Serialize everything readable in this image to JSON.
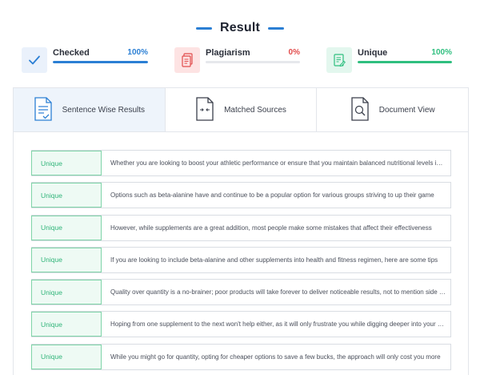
{
  "header": {
    "title": "Result"
  },
  "stats": [
    {
      "label": "Checked",
      "percent_text": "100%",
      "value": 1.0,
      "color": "#2b7fd4",
      "bg": "#eaf1fb",
      "icon": "checkmark-icon"
    },
    {
      "label": "Plagiarism",
      "percent_text": "0%",
      "value": 0.0,
      "color": "#e24c4c",
      "bg": "#fde3e3",
      "icon": "document-copy-icon"
    },
    {
      "label": "Unique",
      "percent_text": "100%",
      "value": 1.0,
      "color": "#2fbf7f",
      "bg": "#e3f7ee",
      "icon": "document-edit-icon"
    }
  ],
  "tabs": [
    {
      "label": "Sentence Wise Results",
      "icon": "sentence-document-icon",
      "active": true
    },
    {
      "label": "Matched Sources",
      "icon": "matched-sources-icon",
      "active": false
    },
    {
      "label": "Document View",
      "icon": "document-search-icon",
      "active": false
    }
  ],
  "results": [
    {
      "status": "Unique",
      "sentence": "Whether you are looking to boost your athletic performance or ensure that you maintain balanced nutritional levels in your diet"
    },
    {
      "status": "Unique",
      "sentence": "Options such as beta-alanine have and continue to be a popular option for various groups striving to up their game"
    },
    {
      "status": "Unique",
      "sentence": "However, while supplements are a great addition, most people make some mistakes that affect their effectiveness"
    },
    {
      "status": "Unique",
      "sentence": "If you are looking to include beta-alanine and other supplements into health and fitness regimen, here are some tips"
    },
    {
      "status": "Unique",
      "sentence": "Quality over quantity is a no-brainer; poor products will take forever to deliver noticeable results, not to mention side effects"
    },
    {
      "status": "Unique",
      "sentence": "Hoping from one supplement to the next won't help either, as it will only frustrate you while digging deeper into your pockets"
    },
    {
      "status": "Unique",
      "sentence": "While you might go for quantity, opting for cheaper options to save a few bucks, the approach will only cost you more"
    }
  ]
}
